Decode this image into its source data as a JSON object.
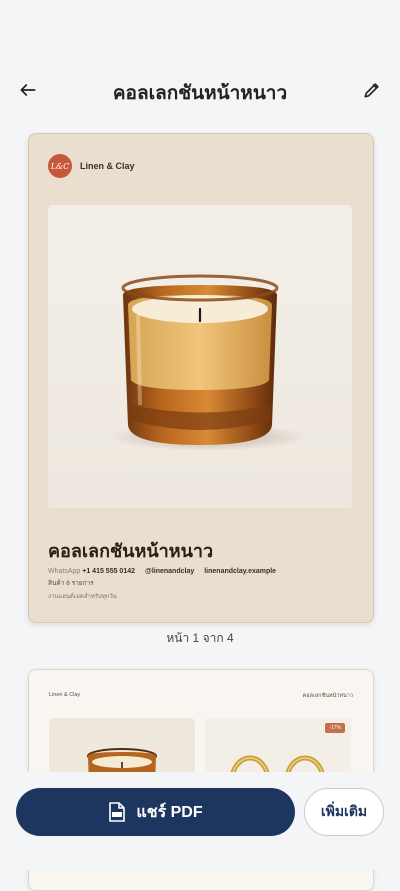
{
  "header": {
    "title": "คอลเลกชันหน้าหนาว",
    "back_icon": "arrow-left-icon",
    "edit_icon": "pencil-icon"
  },
  "catalog_page1": {
    "brand_logo": "L&C",
    "brand_name": "Linen & Clay",
    "product_image": "amber-glass-candle",
    "title": "คอลเลกชันหน้าหนาว",
    "whatsapp_label": "WhatsApp",
    "whatsapp_number": "+1 415 555 0142",
    "instagram": "@linenandclay",
    "website": "linenandclay.example",
    "item_count": "สินค้า 6 รายการ",
    "tagline": "งานแฮนด์เมดสำหรับทุกวัน"
  },
  "page_indicator": "หน้า 1 จาก 4",
  "catalog_page2": {
    "brand_name": "Linen & Clay",
    "title": "คอลเลกชันหน้าหนาว",
    "discount_badge": "-17%",
    "item1_image": "amber-glass-candle",
    "item2_image": "gold-hoop-earrings"
  },
  "actions": {
    "share_label": "แชร์ PDF",
    "share_icon": "pdf-file-icon",
    "more_label": "เพิ่มเติม"
  },
  "colors": {
    "primary": "#1d365f",
    "page_bg": "#f4f5f7",
    "card_beige": "#eadfce",
    "logo": "#c7573a"
  }
}
